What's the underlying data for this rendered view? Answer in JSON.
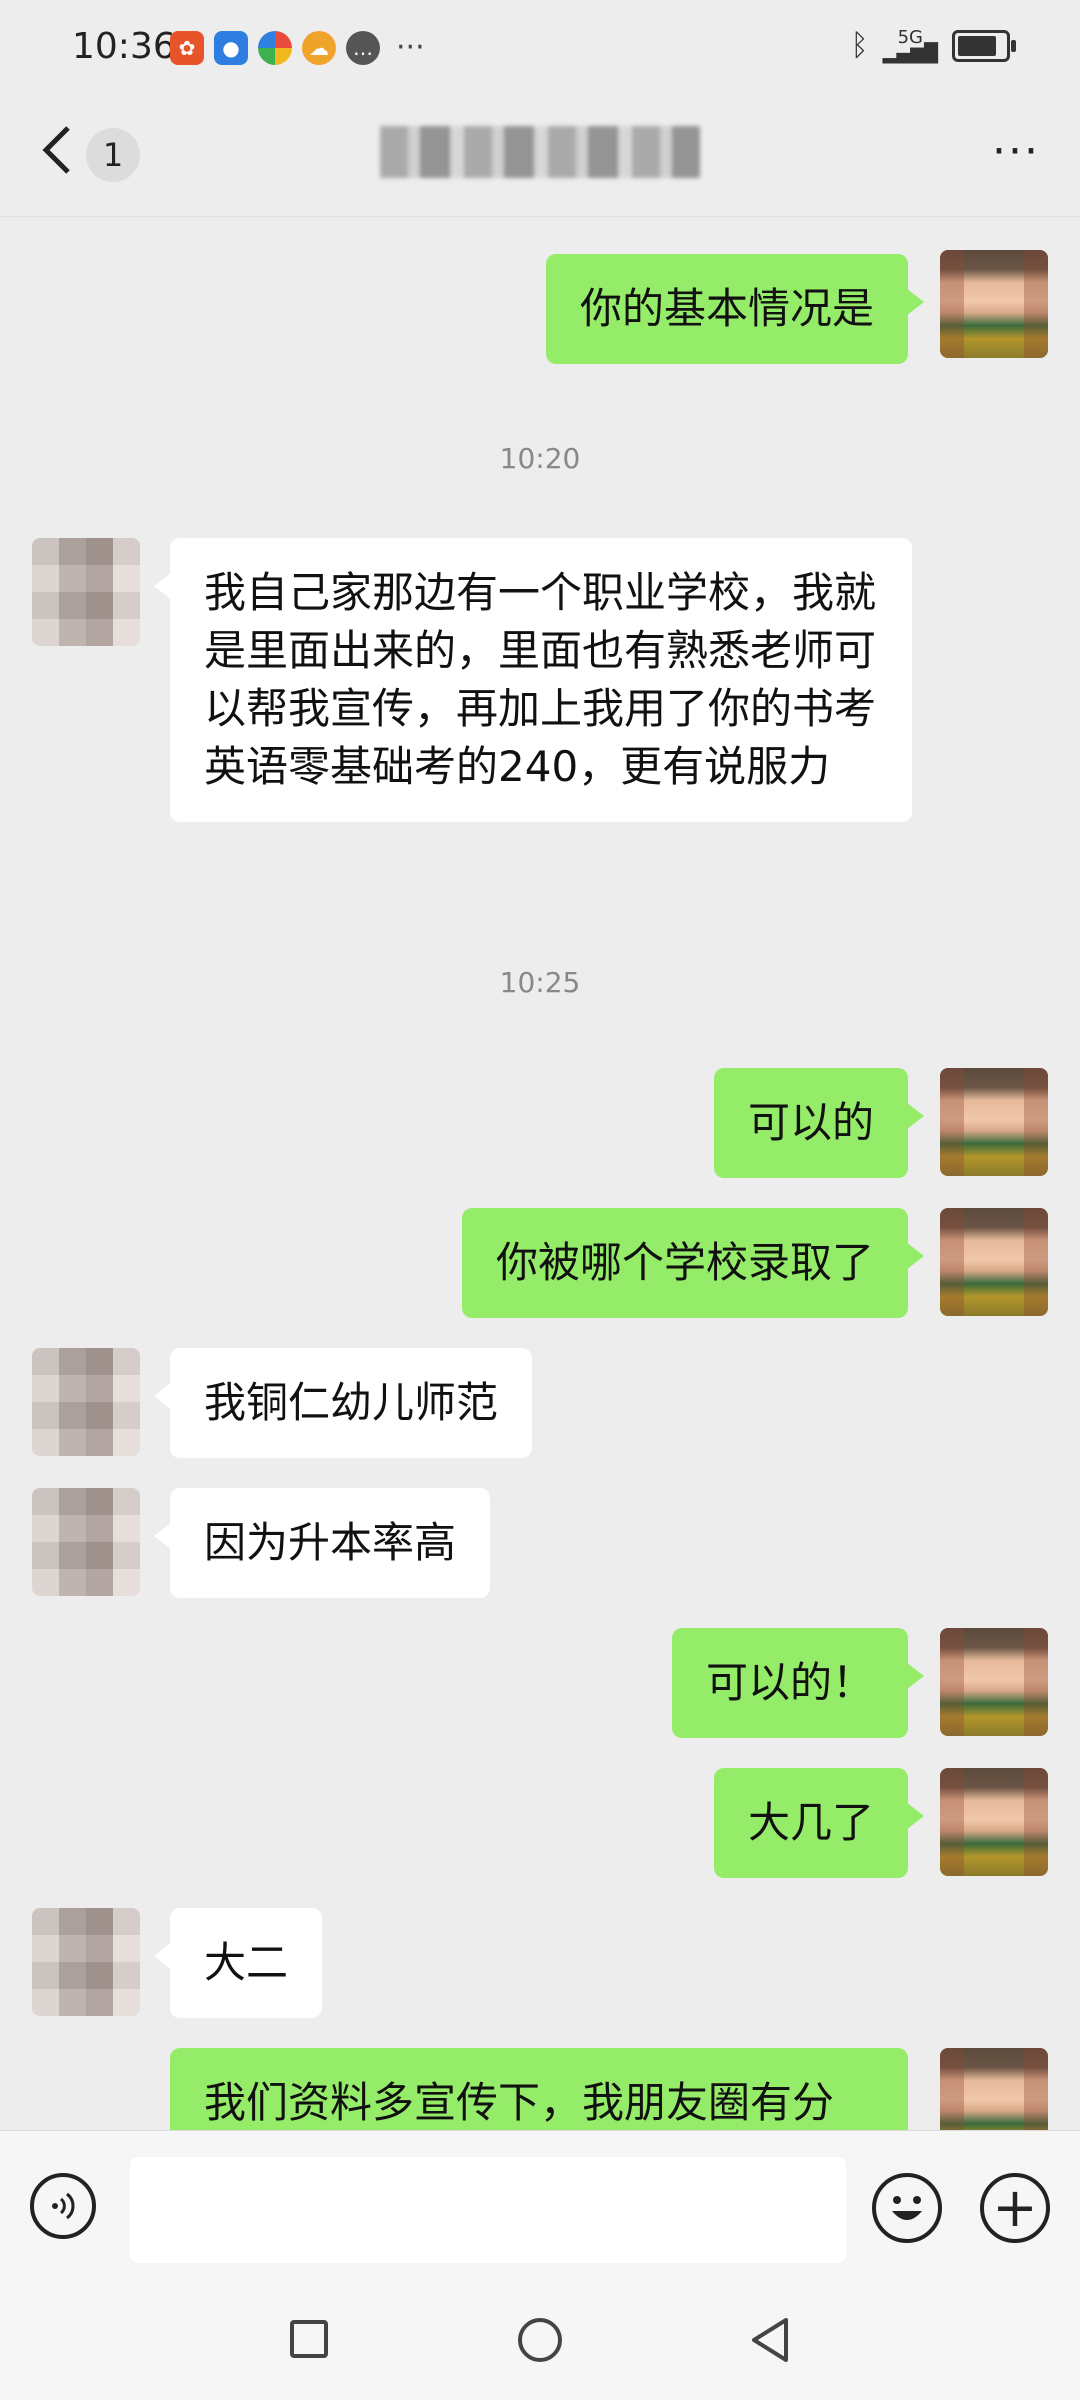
{
  "status_bar": {
    "time": "10:36",
    "network": "5G",
    "notification_icons": [
      "baidu-app-icon",
      "browser-icon",
      "color-app-icon",
      "weather-icon",
      "message-icon"
    ],
    "more": "···"
  },
  "header": {
    "unread_count": "1",
    "title": "",
    "menu": "···"
  },
  "messages": [
    {
      "type": "text",
      "side": "me",
      "text": "你的基本情况是"
    },
    {
      "type": "time",
      "text": "10:20"
    },
    {
      "type": "text",
      "side": "peer",
      "text": "我自己家那边有一个职业学校，我就是里面出来的，里面也有熟悉老师可以帮我宣传，再加上我用了你的书考英语零基础考的240，更有说服力"
    },
    {
      "type": "time",
      "text": "10:25"
    },
    {
      "type": "text",
      "side": "me",
      "text": "可以的"
    },
    {
      "type": "text",
      "side": "me",
      "text": "你被哪个学校录取了"
    },
    {
      "type": "text",
      "side": "peer",
      "text": "我铜仁幼儿师范"
    },
    {
      "type": "text",
      "side": "peer",
      "text": "因为升本率高"
    },
    {
      "type": "text",
      "side": "me",
      "text": "可以的！"
    },
    {
      "type": "text",
      "side": "me",
      "text": "大几了"
    },
    {
      "type": "text",
      "side": "peer",
      "text": "大二"
    },
    {
      "type": "text",
      "side": "me",
      "text": "我们资料多宣传下，我朋友圈有分"
    }
  ],
  "input": {
    "value": "",
    "placeholder": ""
  },
  "colors": {
    "background": "#ededed",
    "my_bubble": "#95ec69",
    "peer_bubble": "#ffffff"
  }
}
